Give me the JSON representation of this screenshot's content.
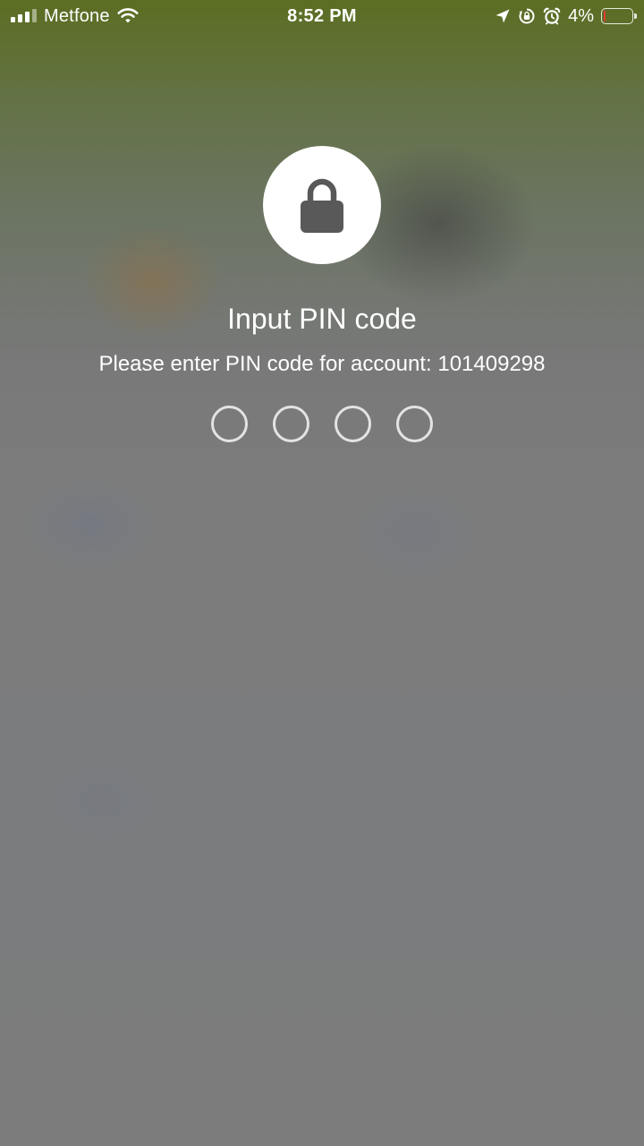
{
  "status_bar": {
    "carrier": "Metfone",
    "time": "8:52 PM",
    "battery_percent_label": "4%",
    "battery_level": 0.04,
    "icons": [
      "cellular-signal-icon",
      "wifi-icon",
      "location-arrow-icon",
      "rotation-lock-icon",
      "alarm-clock-icon",
      "battery-icon"
    ]
  },
  "lock": {
    "icon": "padlock-icon",
    "title": "Input PIN code",
    "subtitle": "Please enter PIN code for account: 101409298"
  },
  "pin": {
    "length": 4,
    "entered": 0
  },
  "colors": {
    "battery_low": "#e53b30",
    "text": "#ffffff"
  }
}
